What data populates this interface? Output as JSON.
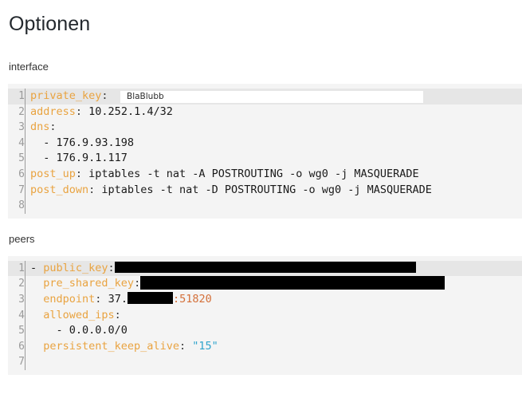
{
  "page": {
    "title": "Optionen"
  },
  "sections": [
    {
      "label": "interface"
    },
    {
      "label": "peers"
    }
  ],
  "interface_block": {
    "label": "interface",
    "lines": [
      {
        "num": "1",
        "highlight": true,
        "key": "private_key",
        "colon": ":",
        "value": ""
      },
      {
        "num": "2",
        "highlight": false,
        "key": "address",
        "colon": ":",
        "value": " 10.252.1.4/32"
      },
      {
        "num": "3",
        "highlight": false,
        "key": "dns",
        "colon": ":",
        "value": ""
      },
      {
        "num": "4",
        "highlight": false,
        "key": "",
        "colon": "",
        "value": "  - 176.9.93.198"
      },
      {
        "num": "5",
        "highlight": false,
        "key": "",
        "colon": "",
        "value": "  - 176.9.1.117"
      },
      {
        "num": "6",
        "highlight": false,
        "key": "post_up",
        "colon": ":",
        "value": " iptables -t nat -A POSTROUTING -o wg0 -j MASQUERADE"
      },
      {
        "num": "7",
        "highlight": false,
        "key": "post_down",
        "colon": ":",
        "value": " iptables -t nat -D POSTROUTING -o wg0 -j MASQUERADE"
      },
      {
        "num": "8",
        "highlight": false,
        "key": "",
        "colon": "",
        "value": ""
      }
    ],
    "private_key_input": {
      "value": "BlaBlubb",
      "placeholder": ""
    }
  },
  "peers_block": {
    "label": "peers",
    "lines": [
      {
        "num": "1",
        "highlight": true,
        "prefix": "- ",
        "key": "public_key",
        "colon": ":",
        "value": "",
        "redacted": "public-key-redacted"
      },
      {
        "num": "2",
        "highlight": false,
        "prefix": "  ",
        "key": "pre_shared_key",
        "colon": ":",
        "value": "",
        "redacted": "pre-shared-key-redacted"
      },
      {
        "num": "3",
        "highlight": false,
        "prefix": "  ",
        "key": "endpoint",
        "colon": ":",
        "value": " 37.",
        "redacted": "endpoint-ip-redacted",
        "port": ":51820"
      },
      {
        "num": "4",
        "highlight": false,
        "prefix": "  ",
        "key": "allowed_ips",
        "colon": ":",
        "value": ""
      },
      {
        "num": "5",
        "highlight": false,
        "prefix": "",
        "key": "",
        "colon": "",
        "value": "    - 0.0.0.0/0"
      },
      {
        "num": "6",
        "highlight": false,
        "prefix": "  ",
        "key": "persistent_keep_alive",
        "colon": ":",
        "value": "",
        "string": "\"15\""
      },
      {
        "num": "7",
        "highlight": false,
        "prefix": "",
        "key": "",
        "colon": "",
        "value": ""
      }
    ]
  },
  "colors": {
    "key": "#e9a340",
    "string": "#2fa4cc",
    "port": "#d4703a",
    "block_bg": "#f4f4f4",
    "highlight_bg": "#e6e6e6",
    "redaction": "#000000"
  }
}
